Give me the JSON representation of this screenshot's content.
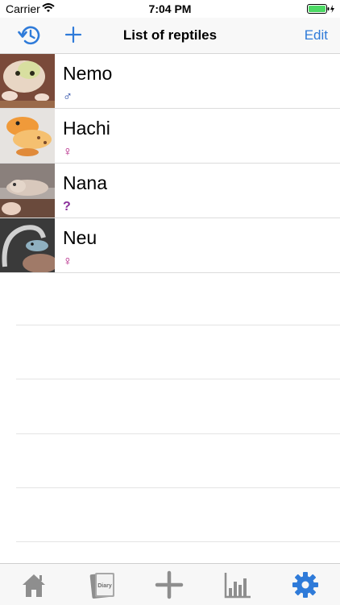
{
  "status_bar": {
    "carrier": "Carrier",
    "time": "7:04 PM"
  },
  "nav": {
    "title": "List of reptiles",
    "edit_label": "Edit"
  },
  "reptiles": [
    {
      "name": "Nemo",
      "sex_symbol": "♂",
      "sex": "male"
    },
    {
      "name": "Hachi",
      "sex_symbol": "♀",
      "sex": "female"
    },
    {
      "name": "Nana",
      "sex_symbol": "?",
      "sex": "unknown"
    },
    {
      "name": "Neu",
      "sex_symbol": "♀",
      "sex": "female"
    }
  ],
  "tabbar": {
    "diary_label": "Diary",
    "items": [
      "home-icon",
      "diary-icon",
      "add-icon",
      "chart-icon",
      "settings-icon"
    ],
    "selected": "settings-icon"
  },
  "colors": {
    "accent": "#2f7bd9",
    "male": "#1c3fa0",
    "female": "#b0157e"
  }
}
